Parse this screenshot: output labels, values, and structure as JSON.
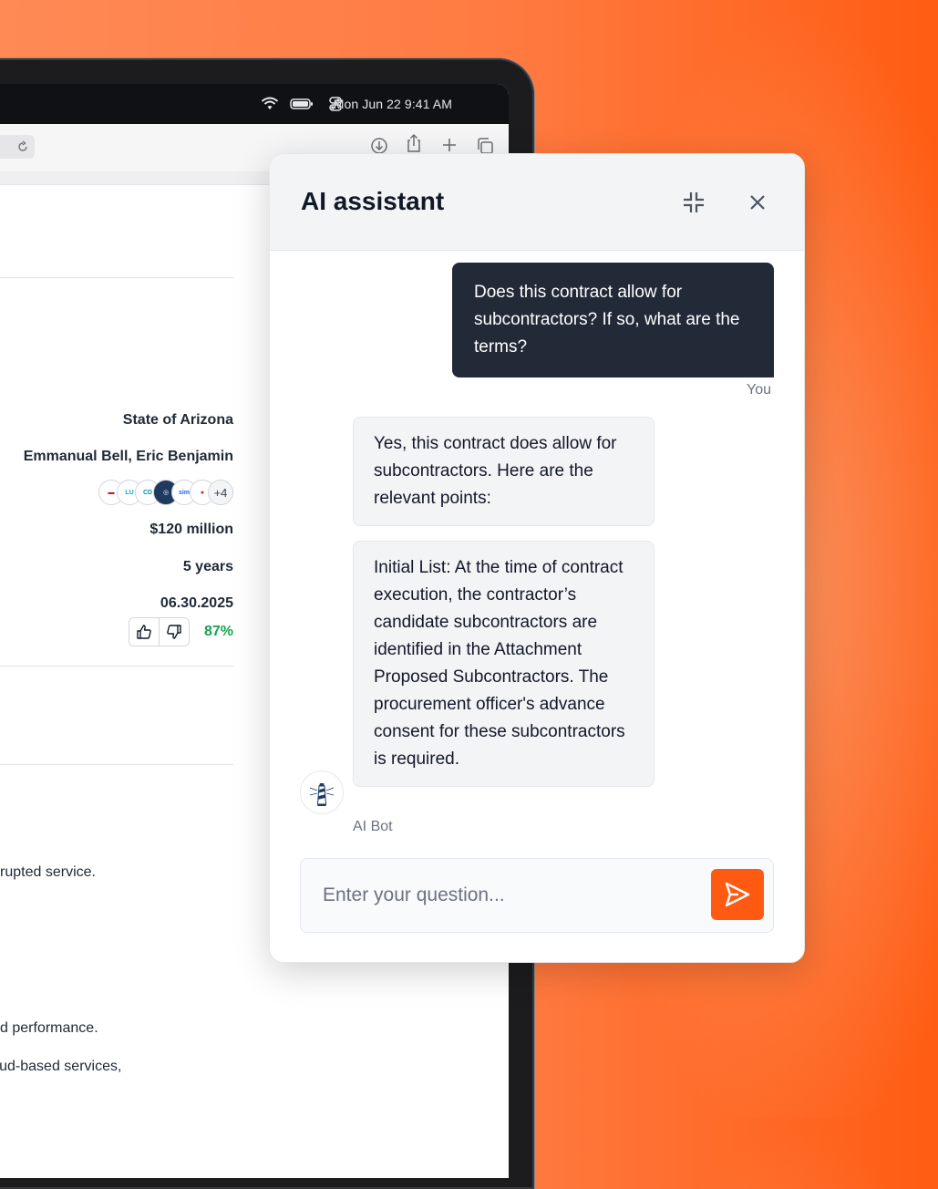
{
  "menubar": {
    "datetime": "Mon Jun 22  9:41 AM"
  },
  "document": {
    "fields": [
      {
        "value": "State of Arizona"
      },
      {
        "value": "Emmanual Bell, Eric Benjamin"
      },
      {
        "value": "$120 million"
      },
      {
        "value": "5 years"
      },
      {
        "value": "06.30.2025"
      }
    ],
    "vendor_logos_more": "+4",
    "confidence": "87%",
    "body_lines": [
      "ninterrupted service.",
      "ne and performance.",
      " or cloud-based services,"
    ]
  },
  "assistant": {
    "title": "AI assistant",
    "user_message": "Does this contract allow for subcontractors? If so, what are the terms?",
    "user_label": "You",
    "bot_messages": [
      "Yes, this contract does allow for subcontractors. Here are the relevant points:",
      "Initial List: At the time of contract execution, the contractor’s candidate subcontractors are identified in the Attachment Proposed Subcontractors. The procurement officer's advance consent for these subcontractors is required."
    ],
    "bot_label": "AI Bot",
    "input_placeholder": "Enter your question..."
  },
  "colors": {
    "accent": "#ff5a12",
    "user_bubble": "#222a38",
    "positive": "#16a34a"
  }
}
